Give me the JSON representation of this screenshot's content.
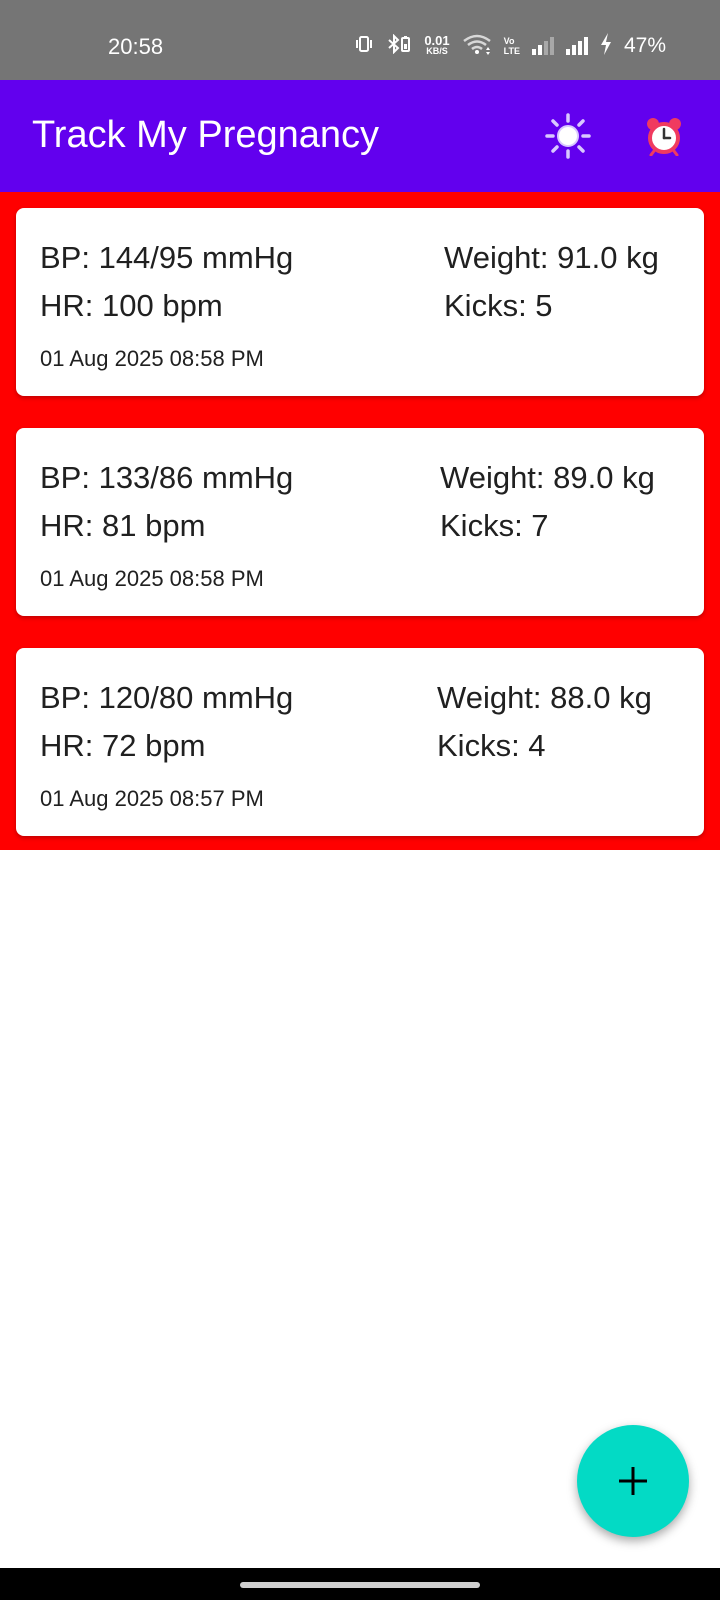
{
  "status_bar": {
    "time": "20:58",
    "net_speed_value": "0.01",
    "net_speed_unit": "KB/S",
    "volte_top": "Vo",
    "volte_bottom": "LTE",
    "battery": "47%"
  },
  "app_bar": {
    "title": "Track My Pregnancy",
    "background": "#6200ee",
    "icons": [
      "sun-icon",
      "alarm-clock-icon"
    ]
  },
  "list": {
    "background": "#ff0000",
    "entries": [
      {
        "bp": "BP: 144/95 mmHg",
        "hr": "HR: 100 bpm",
        "weight": "Weight: 91.0 kg",
        "kicks": "Kicks: 5",
        "date": "01 Aug 2025 08:58 PM"
      },
      {
        "bp": "BP: 133/86 mmHg",
        "hr": "HR: 81 bpm",
        "weight": "Weight: 89.0 kg",
        "kicks": "Kicks: 7",
        "date": "01 Aug 2025 08:58 PM"
      },
      {
        "bp": "BP: 120/80 mmHg",
        "hr": "HR: 72 bpm",
        "weight": "Weight: 88.0 kg",
        "kicks": "Kicks: 4",
        "date": "01 Aug 2025 08:57 PM"
      }
    ]
  },
  "fab": {
    "icon": "plus-icon",
    "color": "#03dac5"
  }
}
